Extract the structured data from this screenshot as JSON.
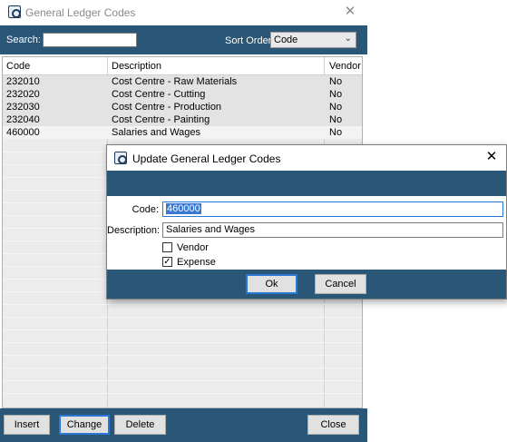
{
  "main": {
    "title": "General Ledger Codes",
    "close_glyph": "✕",
    "search_label": "Search:",
    "search_value": "",
    "sort_label": "Sort Order",
    "sort_value": "Code",
    "columns": [
      "Code",
      "Description",
      "Vendor"
    ],
    "rows": [
      {
        "code": "232010",
        "description": "Cost Centre - Raw Materials",
        "vendor": "No"
      },
      {
        "code": "232020",
        "description": "Cost Centre - Cutting",
        "vendor": "No"
      },
      {
        "code": "232030",
        "description": "Cost Centre - Production",
        "vendor": "No"
      },
      {
        "code": "232040",
        "description": "Cost Centre - Painting",
        "vendor": "No"
      },
      {
        "code": "460000",
        "description": "Salaries and Wages",
        "vendor": "No"
      }
    ],
    "buttons": {
      "insert": "Insert",
      "change": "Change",
      "delete": "Delete",
      "close": "Close"
    }
  },
  "dialog": {
    "title": "Update General Ledger Codes",
    "close_glyph": "✕",
    "code_label": "Code:",
    "code_value": "460000",
    "description_label": "Description:",
    "description_value": "Salaries and Wages",
    "vendor_label": "Vendor",
    "vendor_checked": false,
    "expense_label": "Expense",
    "expense_checked": true,
    "ok_label": "Ok",
    "cancel_label": "Cancel",
    "check_glyph": "✓"
  },
  "colors": {
    "accent": "#2a5677",
    "focus": "#2b78d4"
  },
  "icons": {
    "app": "ledger-app-icon",
    "close": "close-icon",
    "dropdown": "chevron-down-icon",
    "checkbox": "checkbox"
  }
}
